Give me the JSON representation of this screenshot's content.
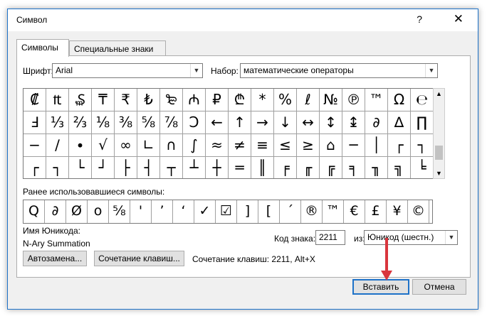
{
  "dialog": {
    "title": "Символ",
    "help": "?",
    "close": "✕"
  },
  "tabs": [
    {
      "label": "Символы"
    },
    {
      "label": "Специальные знаки"
    }
  ],
  "font_label": "Шрифт:",
  "font_value": "Arial",
  "set_label": "Набор:",
  "set_value": "математические операторы",
  "grid_rows": [
    [
      "₡",
      "₶",
      "₷",
      "₸",
      "₹",
      "₺",
      "₻",
      "₼",
      "₽",
      "₾",
      "*",
      "%",
      "ℓ",
      "№",
      "℗",
      "™",
      "Ω",
      "℮",
      "⅍"
    ],
    [
      "Ⅎ",
      "⅓",
      "⅔",
      "⅛",
      "⅜",
      "⅝",
      "⅞",
      "Ↄ",
      "←",
      "↑",
      "→",
      "↓",
      "↔",
      "↕",
      "↨",
      "∂",
      "∆",
      "∏",
      "∑"
    ],
    [
      "−",
      "∕",
      "∙",
      "√",
      "∞",
      "∟",
      "∩",
      "∫",
      "≈",
      "≠",
      "≡",
      "≤",
      "≥",
      "⌂",
      "─",
      "│",
      "┌",
      "┐",
      "│"
    ],
    [
      "┌",
      "┐",
      "└",
      "┘",
      "├",
      "┤",
      "┬",
      "┴",
      "┼",
      "═",
      "║",
      "╒",
      "╓",
      "╔",
      "╕",
      "╖",
      "╗",
      "╘",
      "╙"
    ]
  ],
  "selected_symbol": "∑",
  "recent_label": "Ранее использовавшиеся символы:",
  "recent_symbols": [
    "Q",
    "∂",
    "Ø",
    "o",
    "⅝",
    "'",
    "’",
    "‘",
    "✓",
    "☑",
    "]",
    "[",
    "´",
    "®",
    "™",
    "€",
    "£",
    "¥",
    "©"
  ],
  "unicode_name_label": "Имя Юникода:",
  "unicode_name": "N-Ary Summation",
  "char_code_label": "Код знака:",
  "char_code": "2211",
  "from_label": "из:",
  "from_value": "Юникод (шестн.)",
  "autocorrect_button": "Автозамена...",
  "shortcut_key_button": "Сочетание клавиш...",
  "shortcut_info": "Сочетание клавиш: 2211, Alt+X",
  "insert_button": "Вставить",
  "cancel_button": "Отмена",
  "colors": {
    "accent": "#1e72c8",
    "highlight": "#d9363e"
  }
}
